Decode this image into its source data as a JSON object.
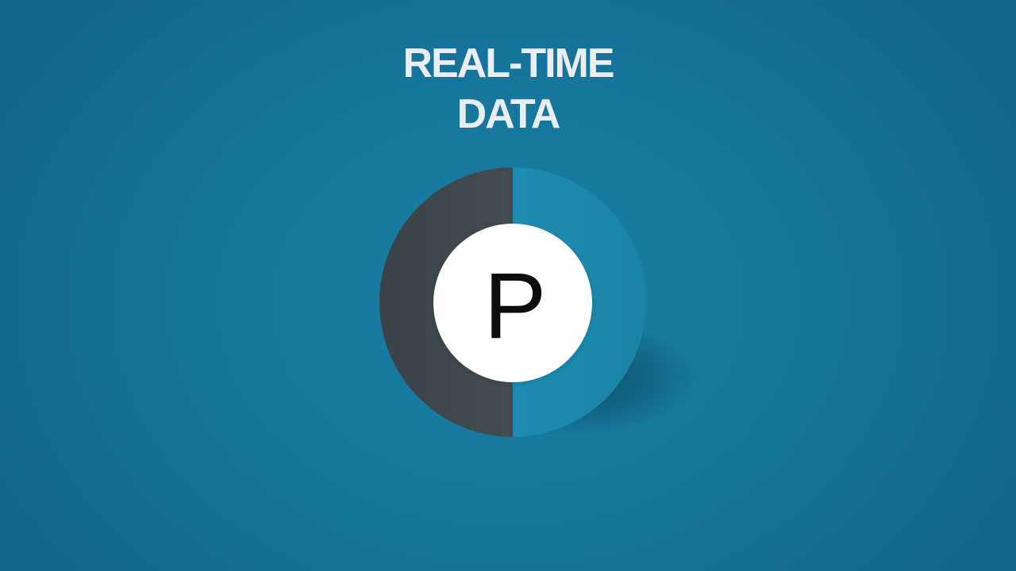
{
  "headline": {
    "line1": "REAL-TIME",
    "line2": "DATA"
  },
  "badge": {
    "letter": "P",
    "left_color": "#3b4549",
    "right_color": "#1d8aad",
    "center_color": "#ffffff"
  },
  "background": {
    "color_center": "#1a7ea3",
    "color_edge": "#136690"
  }
}
